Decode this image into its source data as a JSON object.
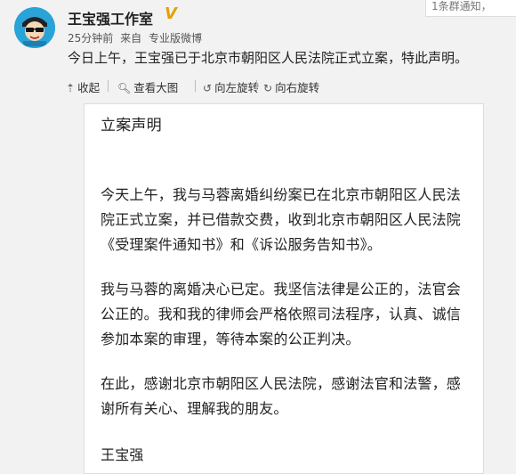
{
  "post": {
    "username": "王宝强工作室",
    "verified_badge": "V",
    "time": "25分钟前",
    "source_prefix": "来自",
    "source": "专业版微博",
    "text": "今日上午，王宝强已于北京市朝阳区人民法院正式立案，特此声明。"
  },
  "notice": "1条群通知，",
  "toolbar": {
    "collapse_label": "收起",
    "view_large_label": "查看大图",
    "rotate_left_label": "向左旋转",
    "rotate_right_label": "向右旋转"
  },
  "statement": {
    "title": "立案声明",
    "para1": "今天上午，我与马蓉离婚纠纷案已在北京市朝阳区人民法院正式立案，并已借款交费，收到北京市朝阳区人民法院《受理案件通知书》和《诉讼服务告知书》。",
    "para2": "我与马蓉的离婚决心已定。我坚信法律是公正的，法官会公正的。我和我的律师会严格依照司法程序，认真、诚信参加本案的审理，等待本案的公正判决。",
    "para3": "在此，感谢北京市朝阳区人民法院，感谢法官和法警，感谢所有关心、理解我的朋友。",
    "signature": "王宝强"
  },
  "icons": [
    "avatar",
    "verified-badge-icon",
    "collapse-icon",
    "search-icon",
    "rotate-left-icon",
    "rotate-right-icon"
  ],
  "colors": {
    "avatar_bg": "#2aa3d8",
    "verified": "#e8a000"
  }
}
